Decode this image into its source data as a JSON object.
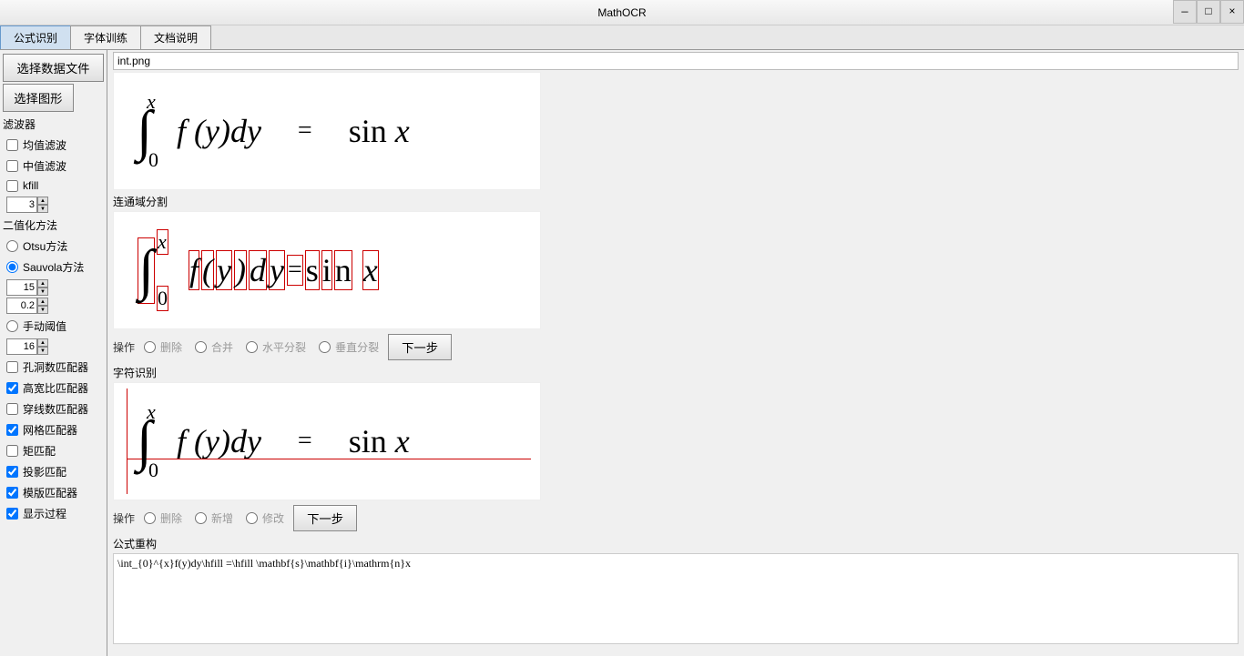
{
  "window": {
    "title": "MathOCR",
    "min": "—",
    "max": "□",
    "close": "×"
  },
  "tabs": {
    "t1": "公式识别",
    "t2": "字体训练",
    "t3": "文档说明"
  },
  "sidebar": {
    "btn_select_data": "选择数据文件",
    "btn_select_image": "选择图形",
    "filter_label": "滤波器",
    "chk_mean": "均值滤波",
    "chk_median": "中值滤波",
    "chk_kfill": "kfill",
    "spin_kfill": "3",
    "binarize_label": "二值化方法",
    "rad_otsu": "Otsu方法",
    "rad_sauvola": "Sauvola方法",
    "spin_sauvola1": "15",
    "spin_sauvola2": "0.2",
    "rad_manual": "手动阈值",
    "spin_manual": "16",
    "chk_hole": "孔洞数匹配器",
    "chk_aspect": "高宽比匹配器",
    "chk_cross": "穿线数匹配器",
    "chk_grid": "网格匹配器",
    "chk_moment": "矩匹配",
    "chk_proj": "投影匹配",
    "chk_template": "模版匹配器",
    "chk_showproc": "显示过程"
  },
  "main": {
    "filename": "int.png",
    "seg_label": "连通域分割",
    "ops1_label": "操作",
    "ops1": {
      "r1": "删除",
      "r2": "合并",
      "r3": "水平分裂",
      "r4": "垂直分裂",
      "next": "下一步"
    },
    "char_label": "字符识别",
    "ops2_label": "操作",
    "ops2": {
      "r1": "删除",
      "r2": "新增",
      "r3": "修改",
      "next": "下一步"
    },
    "recon_label": "公式重构",
    "latex": "\\int_{0}^{x}f(y)dy\\hfill =\\hfill \\mathbf{s}\\mathbf{i}\\mathrm{n}x",
    "formula": {
      "int": "∫",
      "sup": "x",
      "sub": "0",
      "body": "f (y)dy",
      "eq": "=",
      "rhs_sin": "sin ",
      "rhs_x": "x"
    }
  }
}
